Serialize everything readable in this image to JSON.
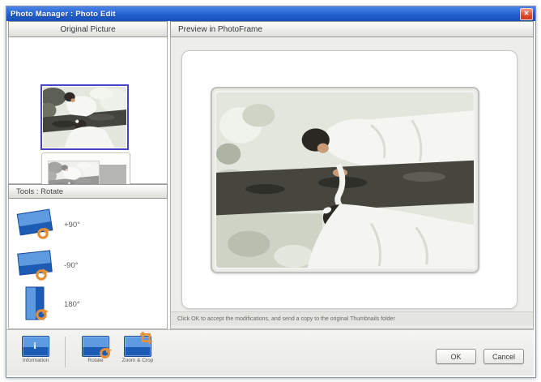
{
  "window": {
    "title": "Photo Manager : Photo Edit",
    "close_glyph": "✕"
  },
  "left_panel": {
    "header": "Original Picture",
    "tools_header": "Tools : Rotate",
    "thumbnails": [
      {
        "name": "wedding-photo-original",
        "selected": true
      },
      {
        "name": "wedding-photo-in-frame",
        "selected": false
      }
    ],
    "rotate_tools": [
      {
        "label": "+90°"
      },
      {
        "label": "-90°"
      },
      {
        "label": "180°"
      }
    ]
  },
  "right_panel": {
    "header": "Preview in PhotoFrame",
    "status": "Click OK to accept the modifications, and send a copy to the original Thumbnails folder"
  },
  "toolbar": {
    "info_glyph": "i",
    "items": [
      {
        "label": "Information"
      },
      {
        "label": "Rotate"
      },
      {
        "label": "Zoom & Crop"
      }
    ]
  },
  "buttons": {
    "ok": "OK",
    "cancel": "Cancel"
  },
  "colors": {
    "titlebar_blue": "#2260cf",
    "close_red": "#dd4a2f",
    "selection_blue": "#4743c6",
    "tool_blue": "#2f7fd0",
    "tool_orange": "#e8923b"
  }
}
